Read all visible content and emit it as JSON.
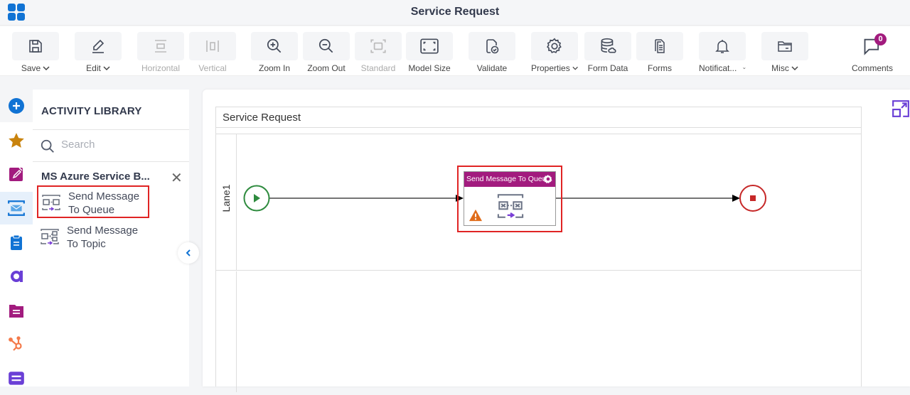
{
  "app": {
    "title": "Service Request"
  },
  "toolbar": {
    "save": "Save",
    "edit": "Edit",
    "horizontal": "Horizontal",
    "vertical": "Vertical",
    "zoom_in": "Zoom In",
    "zoom_out": "Zoom Out",
    "standard": "Standard",
    "model_size": "Model Size",
    "validate": "Validate",
    "properties": "Properties",
    "form_data": "Form Data",
    "forms": "Forms",
    "notifications": "Notificat...",
    "misc": "Misc",
    "comments": "Comments",
    "comments_count": "0"
  },
  "rail": {
    "items": [
      "add-icon",
      "favorites-star-icon",
      "edit-form-icon",
      "azure-service-bus-icon",
      "clipboard-icon",
      "agileworks-icon",
      "folder-doc-icon",
      "hubspot-icon",
      "message-icon"
    ],
    "active": "azure-service-bus-icon"
  },
  "library": {
    "title": "ACTIVITY LIBRARY",
    "search_placeholder": "Search",
    "category": "MS Azure Service B...",
    "items": [
      {
        "line1": "Send Message",
        "line2": "To Queue",
        "selected": true
      },
      {
        "line1": "Send Message",
        "line2": "To Topic",
        "selected": false
      }
    ]
  },
  "canvas": {
    "pool_title": "Service Request",
    "lane_label": "Lane1",
    "task_title": "Send Message To Queu...",
    "colors": {
      "start": "#2e8b3e",
      "end": "#c62828",
      "task_header": "#a21b7e",
      "selection": "#e02424",
      "warning": "#e06c1a"
    }
  }
}
